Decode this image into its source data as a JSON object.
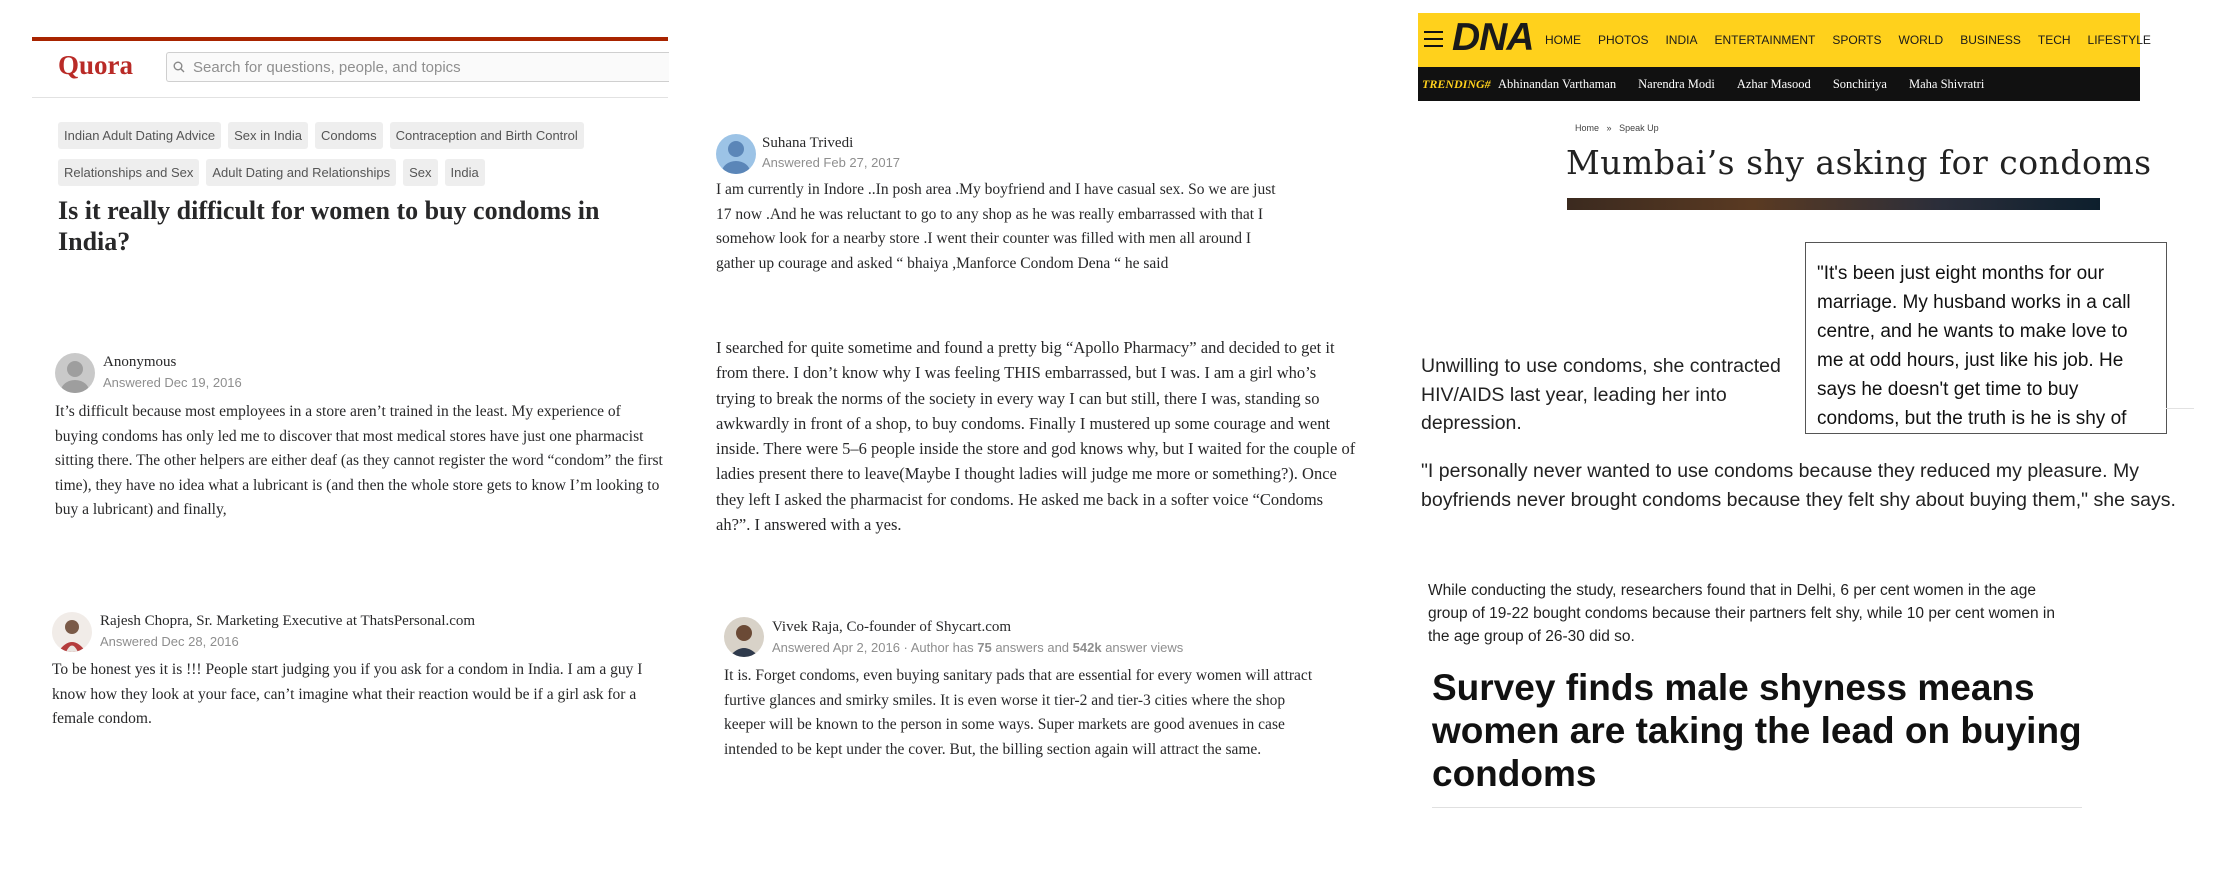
{
  "quora": {
    "logo": "Quora",
    "search_placeholder": "Search for questions, people, and topics",
    "topics": [
      "Indian Adult Dating Advice",
      "Sex in India",
      "Condoms",
      "Contraception and Birth Control",
      "Relationships and Sex",
      "Adult Dating and Relationships",
      "Sex",
      "India"
    ],
    "question": "Is it really difficult for women to buy condoms in India?",
    "answers": [
      {
        "author": "Anonymous",
        "date": "Answered Dec 19, 2016",
        "text": "It’s difficult because most employees in a store aren’t trained in the least. My experience of buying condoms has only led me to discover that most medical stores have just one pharmacist sitting there. The other helpers are either deaf (as they cannot register the word “condom” the first time), they have no idea what a lubricant is (and then the whole store gets to know I’m looking to buy a lubricant) and finally,"
      },
      {
        "author": "Rajesh Chopra, Sr. Marketing Executive at ThatsPersonal.com",
        "date": "Answered Dec 28, 2016",
        "text": "To be honest yes it is !!! People start judging you if you ask for a condom in India. I am a guy I know how they look at your face, can’t imagine what their reaction would be if a girl ask for a female condom."
      },
      {
        "author": "Suhana Trivedi",
        "date": "Answered Feb 27, 2017",
        "text": "I am currently in Indore ..In posh area .My boyfriend and I have casual sex. So we are just 17 now .And he was reluctant to go to any shop as he was really embarrassed with that I somehow look for a nearby store .I went their counter was filled with men all around I gather up courage and asked “ bhaiya ,Manforce Condom Dena “ he said"
      },
      {
        "author": "Vivek Raja, Co-founder of Shycart.com",
        "date": "Answered Apr 2, 2016",
        "meta_prefix": " · Author has ",
        "answers_count": "75",
        "answers_label": " answers and ",
        "views_count": "542k",
        "views_label": " answer views",
        "text": "It is. Forget condoms, even buying sanitary pads that are essential for every women will attract furtive glances and smirky smiles. It is even worse it tier-2 and tier-3 cities where the shop keeper will be known to the person in some ways. Super markets are good avenues in case intended to be kept under the cover. But, the billing section again will attract the same."
      }
    ],
    "continued_text": "I searched for quite sometime and found a pretty big “Apollo Pharmacy” and decided to get it from there. I don’t know why I was feeling THIS embarrassed, but I was. I am a girl who’s trying to break the norms of the society in every way I can but still, there I was, standing so awkwardly in front of a shop, to buy condoms. Finally I mustered up some courage and went inside. There were 5–6 people inside the store and god knows why, but I waited for the couple of ladies present there to leave(Maybe I thought ladies will judge me more or something?). Once they left I asked the pharmacist for condoms. He asked me back in a softer voice “Condoms ah?”. I answered with a yes."
  },
  "dna": {
    "logo": "DNA",
    "nav": [
      "HOME",
      "PHOTOS",
      "INDIA",
      "ENTERTAINMENT",
      "SPORTS",
      "WORLD",
      "BUSINESS",
      "TECH",
      "LIFESTYLE"
    ],
    "trending_label": "TRENDING#",
    "trending": [
      "Abhinandan Varthaman",
      "Narendra Modi",
      "Azhar Masood",
      "Sonchiriya",
      "Maha Shivratri"
    ],
    "breadcrumb": [
      "Home",
      "»",
      "Speak Up"
    ],
    "headline": "Mumbai’s shy asking for condoms",
    "quote": "\"It's been just eight months for our marriage. My husband works in a call centre, and he wants to make love to me at odd hours, just like his job. He says he doesn't get time to buy condoms, but the truth is he is shy of buying it...Now I",
    "para1": "Unwilling to use condoms, she contracted HIV/AIDS last year, leading her into depression.",
    "para2": "\"I personally never wanted to use condoms because they reduced my pleasure. My boyfriends never brought condoms because they felt shy about buying them,\" she says.",
    "para3": "While conducting the study, researchers found that in Delhi, 6 per cent women in the age group of 19-22 bought condoms because their partners felt shy, while 10 per cent women in the age group of 26-30 did so.",
    "subheadline": "Survey finds male shyness means women are taking the lead on buying condoms",
    "colors": {
      "brand_yellow": "#ffd11c",
      "trend_bar": "#111111",
      "quora_red": "#b92b27"
    }
  }
}
